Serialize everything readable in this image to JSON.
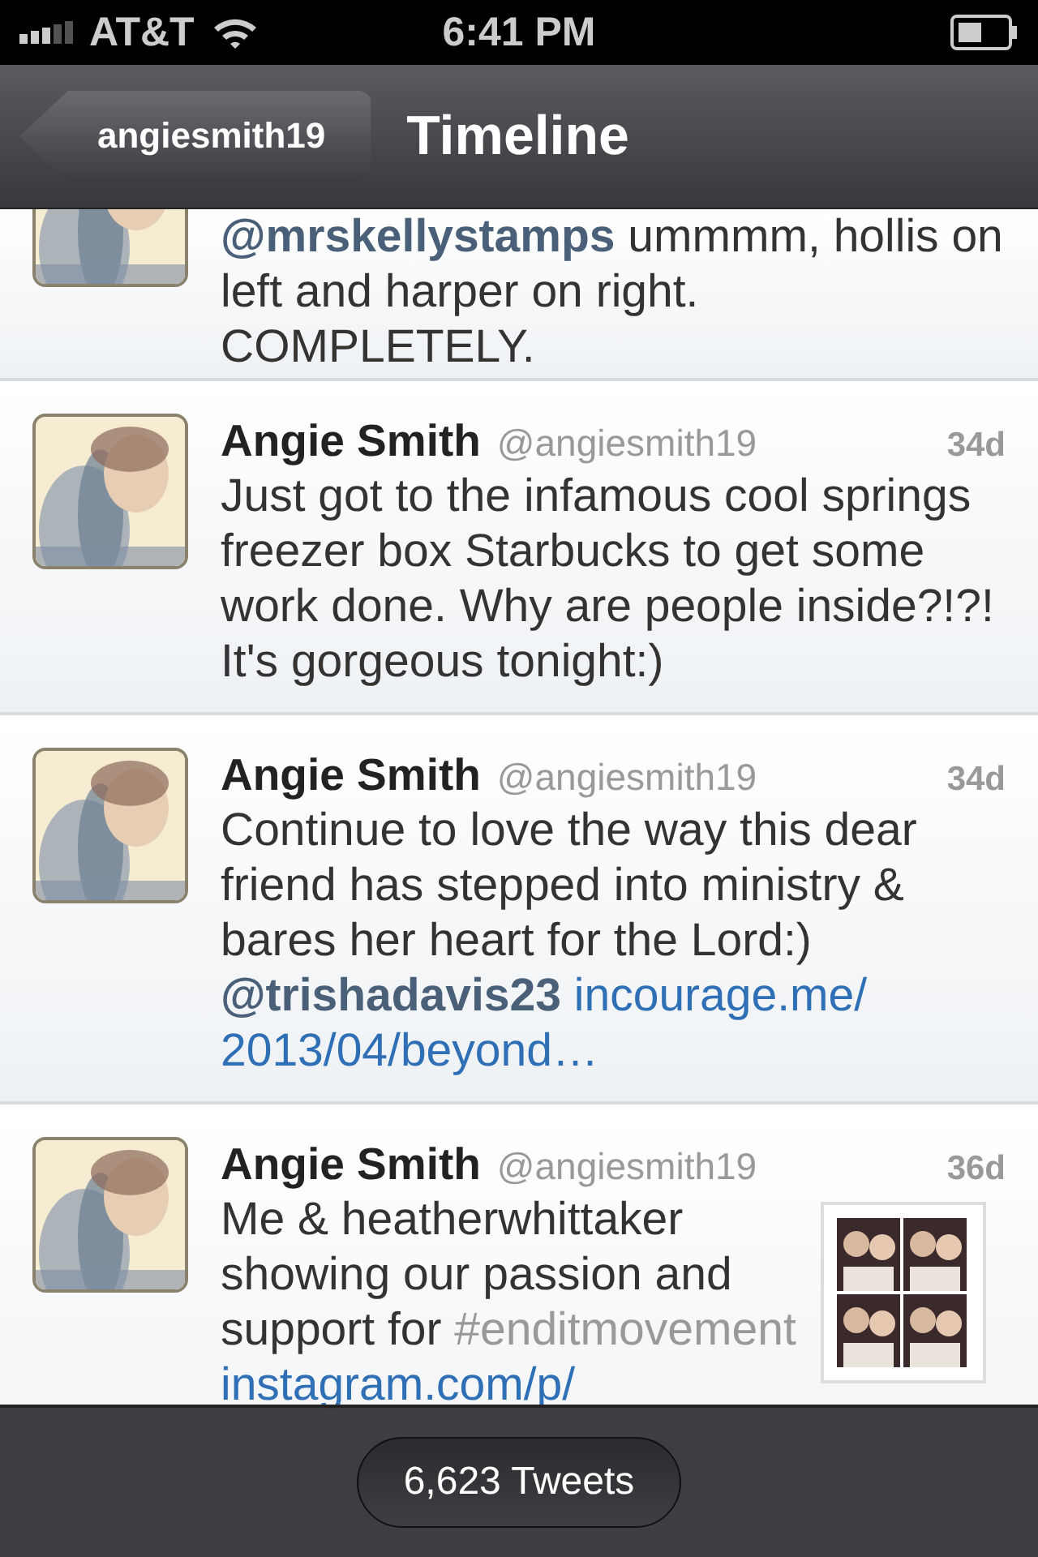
{
  "status_bar": {
    "carrier": "AT&T",
    "time": "6:41 PM"
  },
  "nav_bar": {
    "back_button": "angiesmith19",
    "title": "Timeline"
  },
  "tweets": [
    {
      "body": [
        {
          "kind": "mention",
          "text": "@mrskellystamps"
        },
        {
          "kind": "text",
          "text": " ummmm, hollis on left and harper on right. COMPLETELY."
        }
      ]
    },
    {
      "name": "Angie Smith",
      "handle": "@angiesmith19",
      "age": "34d",
      "body": [
        {
          "kind": "text",
          "text": "Just got to the infamous cool springs freezer box Starbucks to get some work done. Why are people inside?!?! It's gorgeous tonight:)"
        }
      ]
    },
    {
      "name": "Angie Smith",
      "handle": "@angiesmith19",
      "age": "34d",
      "body": [
        {
          "kind": "text",
          "text": "Continue to love the way this dear friend has stepped into ministry & bares her heart for the Lord:) "
        },
        {
          "kind": "mention",
          "text": "@trishadavis23"
        },
        {
          "kind": "link",
          "text": "incourage.me/"
        },
        {
          "kind": "link",
          "text": "2013/04/beyond…"
        }
      ]
    },
    {
      "name": "Angie Smith",
      "handle": "@angiesmith19",
      "age": "36d",
      "media": {
        "kind": "picture"
      },
      "body": [
        {
          "kind": "text",
          "text": "Me & heatherwhittaker showing our passion and support for "
        },
        {
          "kind": "hashtag",
          "text": "#enditmovement"
        },
        {
          "kind": "link",
          "text": "instagram.com/p/"
        }
      ]
    }
  ],
  "footer": {
    "count_button": "6,623 Tweets"
  }
}
